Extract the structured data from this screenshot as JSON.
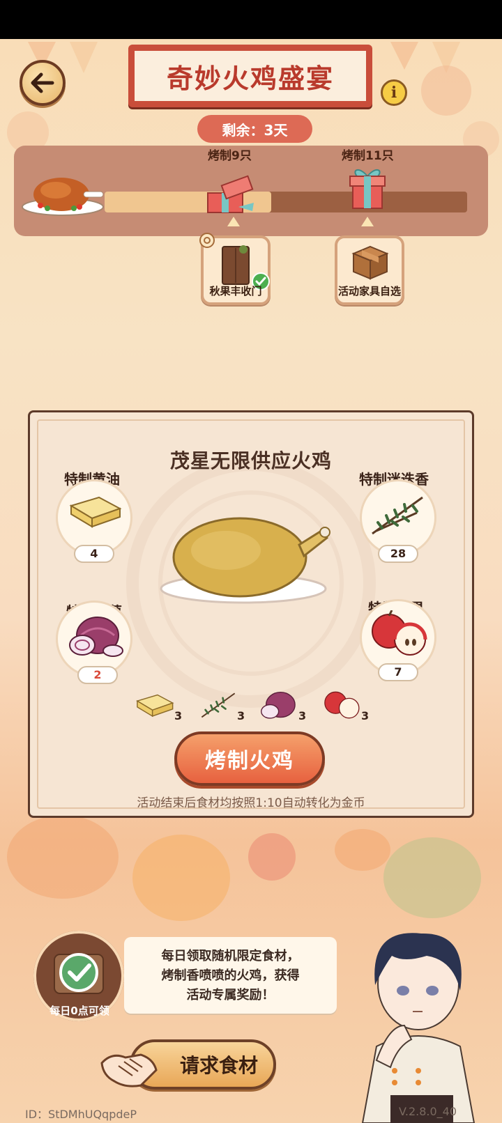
{
  "header": {
    "title": "奇妙火鸡盛宴",
    "remaining": "剩余：3天"
  },
  "progress": {
    "value": 0.46,
    "milestones": [
      {
        "label": "烤制9只",
        "icon": "opened-gift-icon"
      },
      {
        "label": "烤制11只",
        "icon": "gift-box-icon"
      }
    ]
  },
  "rewards": [
    {
      "label": "秋果丰收门",
      "icon": "wooden-door-icon",
      "claimed": true
    },
    {
      "label": "活动家具自选",
      "icon": "cardboard-box-icon",
      "claimed": false
    }
  ],
  "recipe": {
    "title": "茂星无限供应火鸡",
    "ingredients": [
      {
        "name": "特制黄油",
        "count": "4",
        "cost": "3",
        "icon": "butter-icon"
      },
      {
        "name": "特制迷迭香",
        "count": "28",
        "cost": "3",
        "icon": "rosemary-icon"
      },
      {
        "name": "特制洋葱",
        "count": "2",
        "cost": "3",
        "icon": "red-onion-icon",
        "count_color": "#d94a3a"
      },
      {
        "name": "特制苹果",
        "count": "7",
        "cost": "3",
        "icon": "apple-icon"
      }
    ],
    "roast_button": "烤制火鸡",
    "note": "活动结束后食材均按照1:10自动转化为金币"
  },
  "daily": {
    "label": "每日0点可领",
    "speech_lines": [
      "每日领取随机限定食材，",
      "烤制香喷喷的火鸡，获得",
      "活动专属奖励！"
    ]
  },
  "request_button": "请求食材",
  "footer": {
    "id": "ID：StDMhUQqpdeP",
    "version": "V.2.8.0_40"
  }
}
